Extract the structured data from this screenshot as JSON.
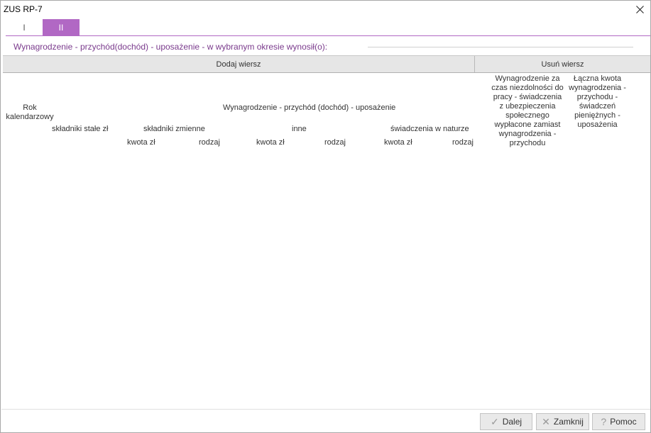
{
  "window": {
    "title": "ZUS RP-7",
    "close_label": "×"
  },
  "tabs": [
    {
      "label": "I",
      "active": false
    },
    {
      "label": "II",
      "active": true
    }
  ],
  "section": {
    "title": "Wynagrodzenie - przychód(dochód) - uposażenie - w wybranym okresie wynosił(o):"
  },
  "toolbar": {
    "add_row": "Dodaj wiersz",
    "delete_row": "Usuń wiersz"
  },
  "table_headers": {
    "year": "Rok kalendarzowy",
    "group": "Wynagrodzenie - przychód (dochód) - uposażenie",
    "fixed": "składniki stałe zł",
    "variable": "składniki zmienne",
    "other": "inne",
    "in_kind": "świadczenia w naturze",
    "sub_cols": {
      "var_amount": "kwota zł",
      "var_type": "rodzaj",
      "other_amount": "kwota zł",
      "other_type": "rodzaj",
      "kind_amount": "kwota zł",
      "kind_type": "rodzaj"
    },
    "sickness": "Wynagrodzenie za czas niezdolności do pracy - świadczenia z ubezpieczenia społecznego wypłacone zamiast wynagrodzenia - przychodu",
    "total": "Łączna kwota wynagrodzenia - przychodu - świadczeń pieniężnych - uposażenia"
  },
  "footer": {
    "next": {
      "label": "Dalej",
      "icon": "check-icon"
    },
    "close": {
      "label": "Zamknij",
      "icon": "x-icon"
    },
    "help": {
      "label": "Pomoc",
      "icon": "question-icon"
    }
  },
  "colors": {
    "accent": "#b168c4",
    "section_title": "#7a3a8c",
    "toolbar_bg": "#e6e6e6"
  }
}
